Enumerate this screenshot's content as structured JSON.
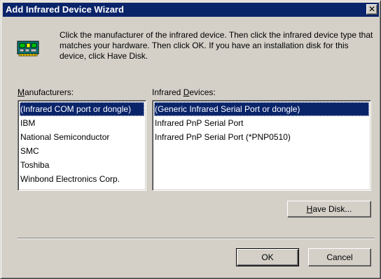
{
  "window": {
    "title": "Add Infrared Device Wizard",
    "close_glyph": "✕"
  },
  "icon": "circuit-board-icon",
  "instructions": "Click the manufacturer of the infrared device.  Then click the infrared device type that matches your hardware.  Then click OK.  If you have an installation disk for this device, click Have Disk.",
  "manufacturers": {
    "label_accel": "M",
    "label_rest": "anufacturers:",
    "items": [
      "(Infrared COM port or dongle)",
      "IBM",
      "National Semiconductor",
      "SMC",
      "Toshiba",
      "Winbond Electronics Corp."
    ],
    "selected": "(Infrared COM port or dongle)"
  },
  "devices": {
    "label_pre": "Infrared ",
    "label_accel": "D",
    "label_rest": "evices:",
    "items": [
      "(Generic Infrared Serial Port or dongle)",
      "Infrared PnP Serial Port",
      "Infrared PnP Serial Port (*PNP0510)"
    ],
    "selected": "(Generic Infrared Serial Port or dongle)"
  },
  "buttons": {
    "have_disk_accel": "H",
    "have_disk_rest": "ave Disk...",
    "ok": "OK",
    "cancel": "Cancel"
  },
  "colors": {
    "titlebar": "#0a246a",
    "face": "#d4d0c8",
    "selection": "#0a246a"
  }
}
